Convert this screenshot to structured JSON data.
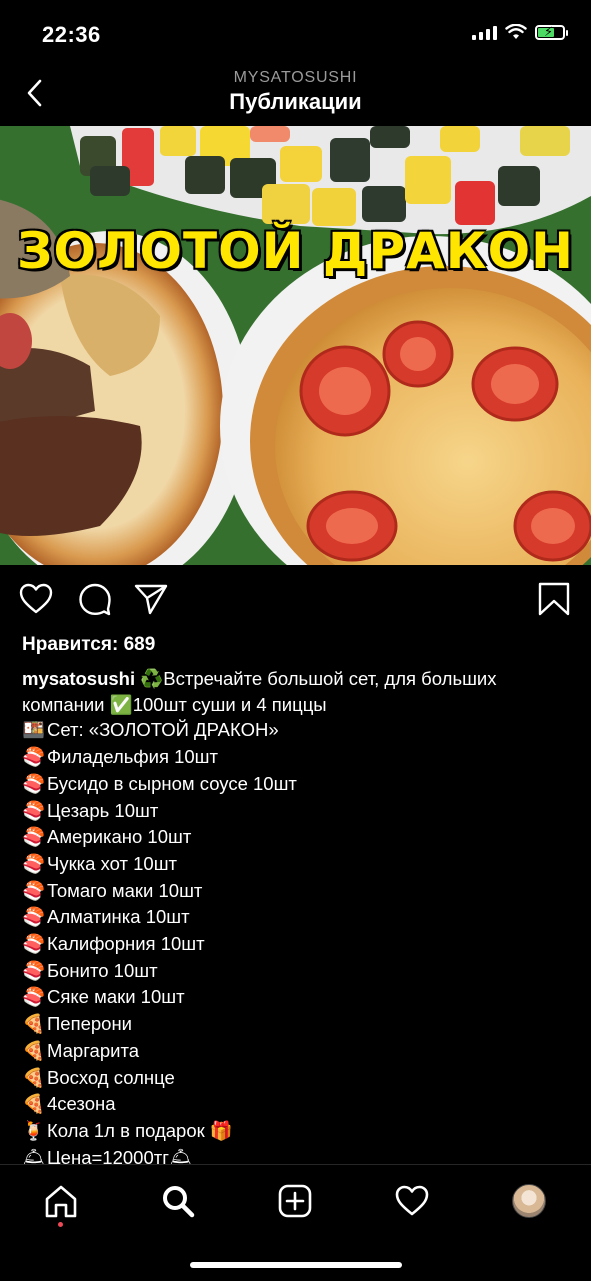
{
  "status_bar": {
    "time": "22:36"
  },
  "header": {
    "username": "MYSATOSUSHI",
    "title": "Публикации"
  },
  "post": {
    "image_banner": "ЗОЛОТОЙ ДРАКОН",
    "likes_text": "Нравится: 689",
    "caption": {
      "username": "mysatosushi",
      "intro_emoji": "♻️",
      "intro_text": "Встречайте большой сет, для больших",
      "intro_cont_pre": "компании",
      "check_emoji": "✅",
      "intro_cont_post": "100шт суши и 4 пиццы",
      "lines": [
        {
          "emoji": "🍱",
          "text": "Сет: «ЗОЛОТОЙ ДРАКОН»"
        },
        {
          "emoji": "🍣",
          "text": "Филадельфия 10шт"
        },
        {
          "emoji": "🍣",
          "text": "Бусидо в сырном соусе 10шт"
        },
        {
          "emoji": "🍣",
          "text": "Цезарь 10шт"
        },
        {
          "emoji": "🍣",
          "text": "Американо 10шт"
        },
        {
          "emoji": "🍣",
          "text": "Чукка хот 10шт"
        },
        {
          "emoji": "🍣",
          "text": "Томаго маки 10шт"
        },
        {
          "emoji": "🍣",
          "text": "Алматинка 10шт"
        },
        {
          "emoji": "🍣",
          "text": "Калифорния 10шт"
        },
        {
          "emoji": "🍣",
          "text": "Бонито 10шт"
        },
        {
          "emoji": "🍣",
          "text": "Сяке маки 10шт"
        },
        {
          "emoji": "🍕",
          "text": "Пеперони"
        },
        {
          "emoji": "🍕",
          "text": "Маргарита"
        },
        {
          "emoji": "🍕",
          "text": "Восход солнце"
        },
        {
          "emoji": "🍕",
          "text": "4сезона"
        },
        {
          "emoji": "🍹",
          "text": "Кола 1л в подарок",
          "trail": "🎁"
        },
        {
          "emoji": "🛎",
          "text": "Цена=12000тг",
          "trail": "🛎"
        }
      ]
    }
  },
  "icons": {
    "back": "chevron-left-icon",
    "like": "heart-icon",
    "comment": "comment-bubble-icon",
    "share": "paper-plane-icon",
    "save": "bookmark-icon",
    "nav_home": "home-icon",
    "nav_search": "search-icon",
    "nav_add": "plus-square-icon",
    "nav_activity": "heart-icon",
    "nav_profile": "avatar"
  },
  "colors": {
    "background": "#000000",
    "muted_text": "#9a9a9a",
    "banner_yellow": "#ffe600",
    "notification_dot": "#ed4956",
    "battery_green": "#4cd964"
  }
}
